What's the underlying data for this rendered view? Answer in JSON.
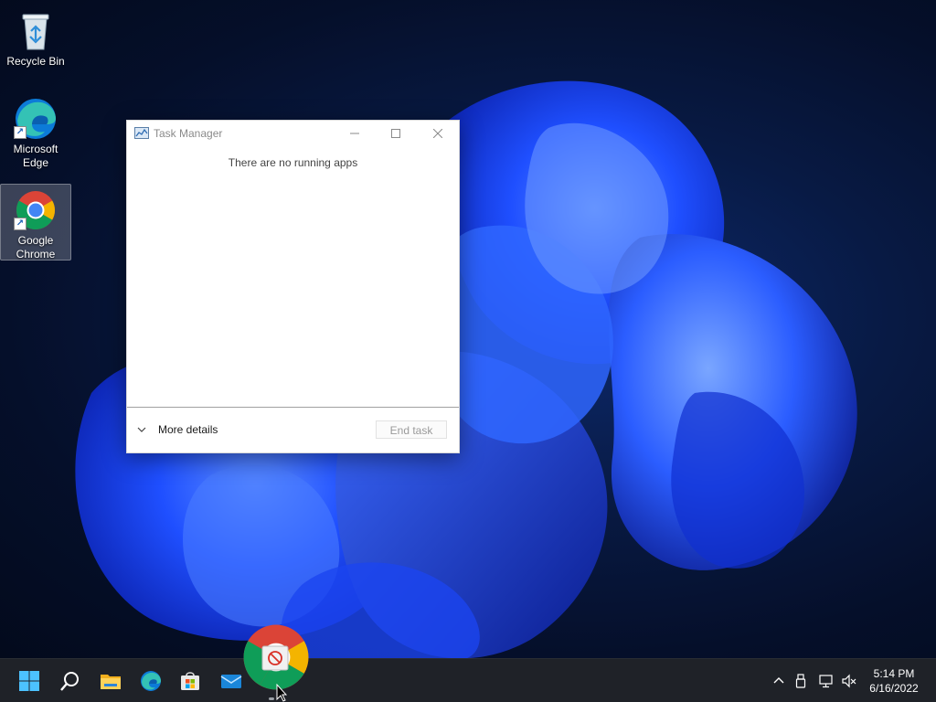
{
  "desktop": {
    "icons": [
      {
        "label": "Recycle Bin",
        "icon": "recycle-bin-icon"
      },
      {
        "label": "Microsoft Edge",
        "icon": "edge-icon"
      },
      {
        "label": "Google Chrome",
        "icon": "chrome-icon",
        "selected": true
      }
    ]
  },
  "task_manager": {
    "title": "Task Manager",
    "message": "There are no running apps",
    "more_details_label": "More details",
    "end_task_label": "End task"
  },
  "taskbar": {
    "pinned": [
      "windows-start-icon",
      "search-icon",
      "file-explorer-icon",
      "edge-icon",
      "microsoft-store-icon",
      "mail-icon"
    ],
    "tray": [
      "chevron-up-icon",
      "usb-icon",
      "network-icon",
      "volume-muted-icon"
    ],
    "clock": {
      "time": "5:14 PM",
      "date": "6/16/2022"
    }
  },
  "colors": {
    "taskbar_bg": "#1f2228",
    "window_bg": "#ffffff",
    "accent_blue": "#1f6fff",
    "disabled_text": "#9a9a9a"
  }
}
